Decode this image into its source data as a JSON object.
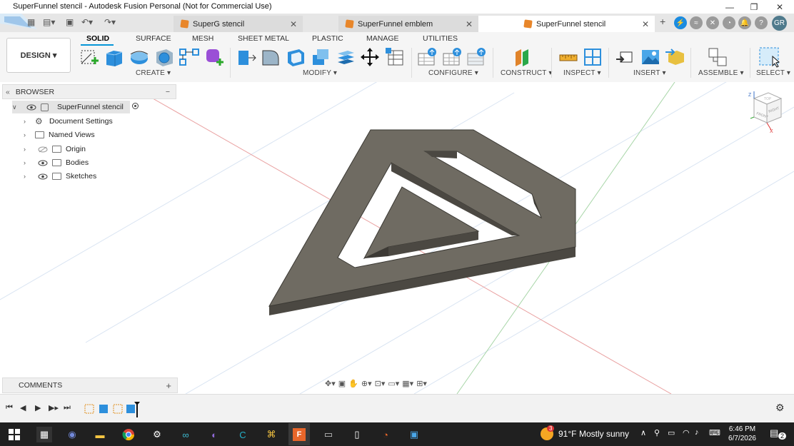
{
  "window": {
    "title": "SuperFunnel stencil - Autodesk Fusion Personal (Not for Commercial Use)",
    "controls": [
      "—",
      "❐",
      "✕"
    ]
  },
  "tabs": [
    {
      "label": "SuperG stencil",
      "active": false
    },
    {
      "label": "SuperFunnel emblem",
      "active": false
    },
    {
      "label": "SuperFunnel stencil",
      "active": true
    }
  ],
  "user": {
    "initials": "GR"
  },
  "ribbon": {
    "workspace": "DESIGN",
    "tabs": [
      "SOLID",
      "SURFACE",
      "MESH",
      "SHEET METAL",
      "PLASTIC",
      "MANAGE",
      "UTILITIES"
    ],
    "active_tab": "SOLID",
    "groups": {
      "create": "CREATE",
      "modify": "MODIFY",
      "configure": "CONFIGURE",
      "construct": "CONSTRUCT",
      "inspect": "INSPECT",
      "insert": "INSERT",
      "assemble": "ASSEMBLE",
      "select": "SELECT"
    }
  },
  "browser": {
    "header": "BROWSER",
    "root": "SuperFunnel stencil",
    "items": [
      "Document Settings",
      "Named Views",
      "Origin",
      "Bodies",
      "Sketches"
    ]
  },
  "comments": {
    "label": "COMMENTS"
  },
  "viewcube": {
    "axis_z": "Z",
    "axis_x": "X",
    "face_front": "FRONT",
    "face_right": "RIGHT",
    "face_top": "TOP"
  },
  "taskbar": {
    "weather_temp": "91°F",
    "weather_text": "Mostly sunny",
    "time": "6:46 PM",
    "date": "6/7/2026",
    "notifications": "2",
    "badge": "3"
  },
  "colors": {
    "accent": "#0696d7",
    "model_top": "#6e6a60",
    "model_side": "#4a4740"
  }
}
